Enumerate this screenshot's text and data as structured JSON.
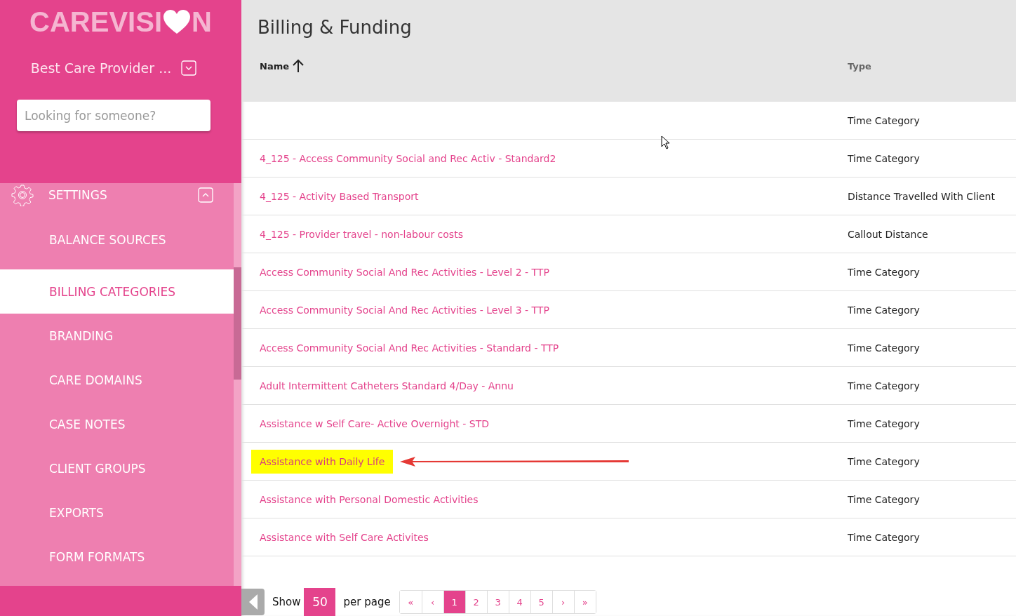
{
  "sidebar": {
    "logo": {
      "before": "CAREVISI",
      "after": "N"
    },
    "provider": "Best Care Provider ...",
    "search": {
      "placeholder": "Looking for someone?"
    },
    "section": {
      "label": "SETTINGS",
      "expanded": true
    },
    "items": [
      {
        "label": "BALANCE SOURCES",
        "selected": false
      },
      {
        "label": "BILLING CATEGORIES",
        "selected": true
      },
      {
        "label": "BRANDING",
        "selected": false
      },
      {
        "label": "CARE DOMAINS",
        "selected": false
      },
      {
        "label": "CASE NOTES",
        "selected": false
      },
      {
        "label": "CLIENT GROUPS",
        "selected": false
      },
      {
        "label": "EXPORTS",
        "selected": false
      },
      {
        "label": "FORM FORMATS",
        "selected": false
      }
    ]
  },
  "page": {
    "title": "Billing & Funding"
  },
  "table": {
    "columns": [
      "Name",
      "Type"
    ],
    "rows": [
      {
        "name": "",
        "type": "Time Category",
        "highlighted": false
      },
      {
        "name": "4_125 - Access Community Social and Rec Activ - Standard2",
        "type": "Time Category",
        "highlighted": false
      },
      {
        "name": "4_125 - Activity Based Transport",
        "type": "Distance Travelled With Client",
        "highlighted": false
      },
      {
        "name": "4_125 - Provider travel - non-labour costs",
        "type": "Callout Distance",
        "highlighted": false
      },
      {
        "name": "Access Community Social And Rec Activities - Level 2 - TTP",
        "type": "Time Category",
        "highlighted": false
      },
      {
        "name": "Access Community Social And Rec Activities - Level 3 - TTP",
        "type": "Time Category",
        "highlighted": false
      },
      {
        "name": "Access Community Social And Rec Activities - Standard - TTP",
        "type": "Time Category",
        "highlighted": false
      },
      {
        "name": "Adult Intermittent Catheters Standard 4/Day - Annu",
        "type": "Time Category",
        "highlighted": false
      },
      {
        "name": "Assistance w Self Care- Active Overnight - STD",
        "type": "Time Category",
        "highlighted": false
      },
      {
        "name": "Assistance with Daily Life",
        "type": "Time Category",
        "highlighted": true
      },
      {
        "name": "Assistance with Personal Domestic Activities",
        "type": "Time Category",
        "highlighted": false
      },
      {
        "name": "Assistance with Self Care Activites",
        "type": "Time Category",
        "highlighted": false
      }
    ]
  },
  "pager": {
    "show": "Show",
    "per_page_value": "50",
    "per_page": "per page",
    "buttons": [
      {
        "label": "«",
        "selected": false
      },
      {
        "label": "‹",
        "selected": false
      },
      {
        "label": "1",
        "selected": true
      },
      {
        "label": "2",
        "selected": false
      },
      {
        "label": "3",
        "selected": false
      },
      {
        "label": "4",
        "selected": false
      },
      {
        "label": "5",
        "selected": false
      },
      {
        "label": "›",
        "selected": false
      },
      {
        "label": "»",
        "selected": false
      }
    ]
  }
}
